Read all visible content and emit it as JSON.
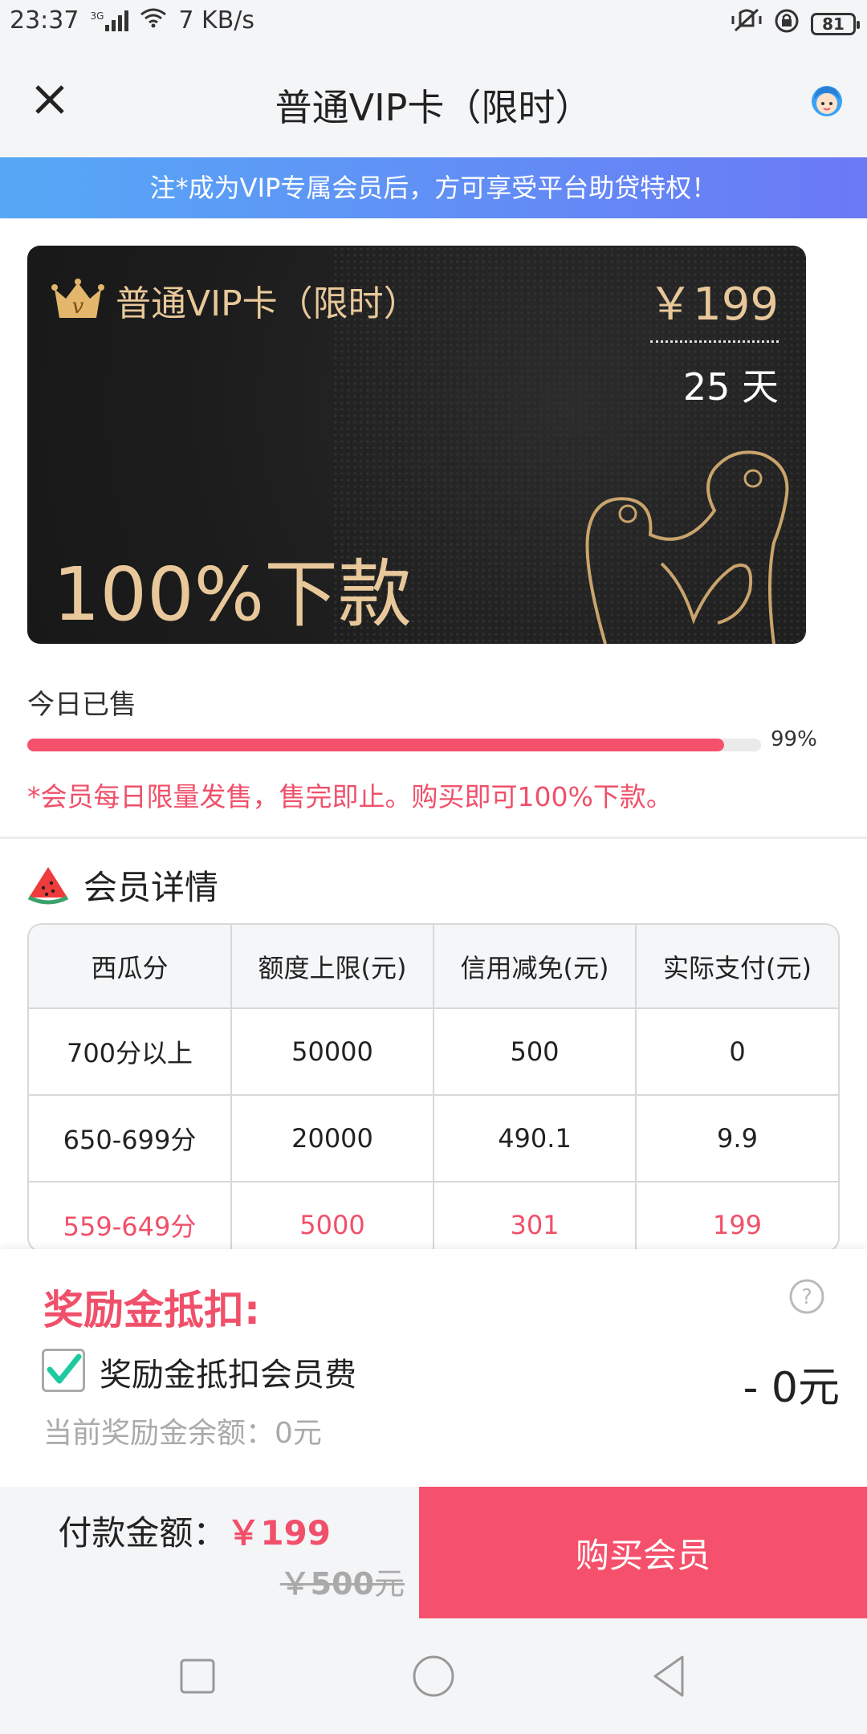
{
  "status_bar": {
    "time": "23:37",
    "network": "3G",
    "speed": "7 KB/s",
    "battery": "81"
  },
  "header": {
    "title": "普通VIP卡（限时）",
    "close_icon": "close-icon",
    "service_icon": "customer-service-avatar-icon"
  },
  "notice": {
    "text": "注*成为VIP专属会员后，方可享受平台助贷特权！"
  },
  "card": {
    "title": "普通VIP卡（限时）",
    "price": "￥199",
    "days": "25 天",
    "slogan": "100%下款",
    "crown_letter": "v"
  },
  "sales": {
    "label": "今日已售",
    "progress_percent": 95,
    "progress_text": "99%",
    "limit_text": "*会员每日限量发售，售完即止。购买即可100%下款。"
  },
  "details": {
    "title": "会员详情",
    "headers": [
      "西瓜分",
      "额度上限(元)",
      "信用减免(元)",
      "实际支付(元)"
    ],
    "rows": [
      [
        "700分以上",
        "50000",
        "500",
        "0"
      ],
      [
        "650-699分",
        "20000",
        "490.1",
        "9.9"
      ],
      [
        "559-649分",
        "5000",
        "301",
        "199"
      ]
    ],
    "highlight_row": 2
  },
  "bonus": {
    "title": "奖励金抵扣:",
    "checkbox_label": "奖励金抵扣会员费",
    "checked": true,
    "deduct": "- 0元",
    "balance": "当前奖励金余额：0元"
  },
  "payment": {
    "label": "付款金额：",
    "amount": "￥199",
    "original_amount": "￥500",
    "original_unit": "元",
    "buy_label": "购买会员"
  },
  "colors": {
    "accent": "#f5516c",
    "gold": "#e8c89a",
    "banner_start": "#56a8f6",
    "banner_end": "#6b79f5"
  }
}
